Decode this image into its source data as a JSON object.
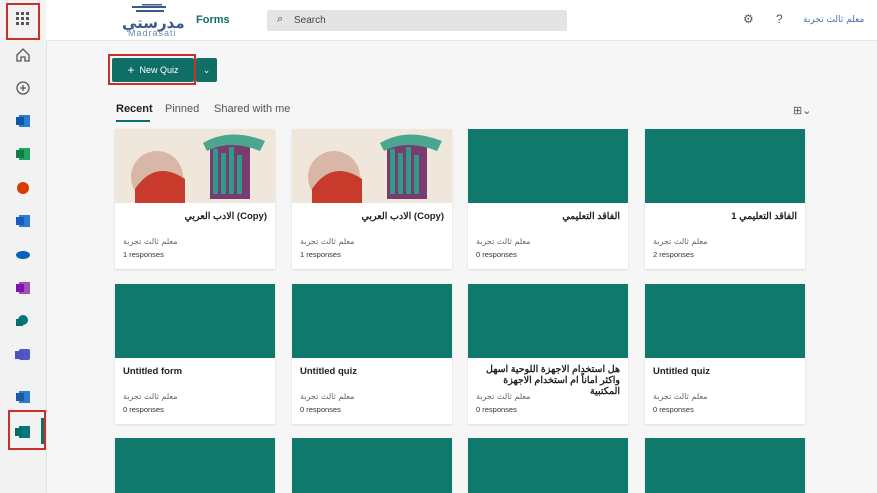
{
  "header": {
    "logo_text": "مدرستي",
    "logo_sub": "Madrasati",
    "app_name": "Forms",
    "search_placeholder": "Search",
    "settings_icon": "gear-icon",
    "help_icon": "?",
    "user_name": "معلم ثالث تجربة"
  },
  "rail": {
    "items": [
      "waffle-icon",
      "home-icon",
      "create-icon",
      "outlook-icon",
      "excel-icon",
      "office-icon",
      "word-icon",
      "onedrive-icon",
      "onenote-icon",
      "sharepoint-icon",
      "teams-icon",
      "powerpoint-icon",
      "forms-icon"
    ]
  },
  "toolbar": {
    "new_quiz_label": "New Quiz",
    "caret": "⌄"
  },
  "tabs": [
    {
      "label": "Recent",
      "active": true
    },
    {
      "label": "Pinned",
      "active": false
    },
    {
      "label": "Shared with me",
      "active": false
    }
  ],
  "cards": [
    {
      "title": "(Copy) الادب العربي",
      "owner": "معلم ثالث تجربة",
      "responses": "1 responses",
      "thumb": "image",
      "rtl": true
    },
    {
      "title": "(Copy) الادب العربي",
      "owner": "معلم ثالث تجربة",
      "responses": "1 responses",
      "thumb": "image",
      "rtl": true
    },
    {
      "title": "الفاقد التعليمي",
      "owner": "معلم ثالث تجربة",
      "responses": "0 responses",
      "thumb": "teal",
      "rtl": true
    },
    {
      "title": "الفاقد التعليمي 1",
      "owner": "معلم ثالث تجربة",
      "responses": "2 responses",
      "thumb": "teal",
      "rtl": true
    },
    {
      "title": "Untitled form",
      "owner": "معلم ثالث تجربة",
      "responses": "0 responses",
      "thumb": "teal",
      "rtl": false
    },
    {
      "title": "Untitled quiz",
      "owner": "معلم ثالث تجربة",
      "responses": "0 responses",
      "thumb": "teal",
      "rtl": false
    },
    {
      "title": "هل استخدام الاجهزة اللوحية اسهل واكثر اماناً ام استخدام الاجهزة المكتبية",
      "owner": "معلم ثالث تجربة",
      "responses": "0 responses",
      "thumb": "teal",
      "rtl": true
    },
    {
      "title": "Untitled quiz",
      "owner": "معلم ثالث تجربة",
      "responses": "0 responses",
      "thumb": "teal",
      "rtl": false
    }
  ],
  "colors": {
    "accent": "#0f6e66",
    "tile": "#0f7a6b",
    "highlight": "#c9302c"
  }
}
